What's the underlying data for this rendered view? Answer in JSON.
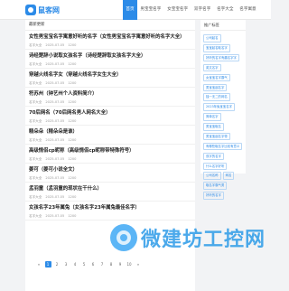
{
  "header": {
    "logo_text": "鼠客网",
    "nav": [
      "首页",
      "男宝宝名字",
      "女宝宝名字",
      "双字名字",
      "名字大全",
      "名字寓意"
    ]
  },
  "main": {
    "title": "最新更新",
    "articles": [
      {
        "title": "女性男宝宝名字寓意好听的名字（女性男宝宝名字寓意好听的名字大全）",
        "author": "名字大全",
        "date": "2025-07-05",
        "views": "1200"
      },
      {
        "title": "诗经楚辞小说取女孩名字（诗经楚辞取女孩名字大全）",
        "author": "名字大全",
        "date": "2025-07-05",
        "views": "1200"
      },
      {
        "title": "穿越火线名字女（穿越火线名字女生大全）",
        "author": "名字大全",
        "date": "2025-07-05",
        "views": "1200"
      },
      {
        "title": "符苏州（钟艺州个人资料简介）",
        "author": "名字大全",
        "date": "2025-07-05",
        "views": "1200"
      },
      {
        "title": "70后网名（70后网名男人网名大全）",
        "author": "名字大全",
        "date": "2025-07-05",
        "views": "1200"
      },
      {
        "title": "精朵朵（精朵朵是谁）",
        "author": "名字大全",
        "date": "2025-07-05",
        "views": "1200"
      },
      {
        "title": "高级情侣cp昵称（高级情侣cp昵称带特殊符号）",
        "author": "名字大全",
        "date": "2025-07-05",
        "views": "1200"
      },
      {
        "title": "姜可（姜可小说全文）",
        "author": "名字大全",
        "date": "2025-07-05",
        "views": "1200"
      },
      {
        "title": "孟羽童（孟羽童的现状在干什么）",
        "author": "名字大全",
        "date": "2025-07-05",
        "views": "1200"
      },
      {
        "title": "女孩名字23年属兔（女孩名字23年属兔最佳名字）",
        "author": "名字大全",
        "date": "2025-07-05",
        "views": "1200"
      }
    ],
    "pagination": [
      "«",
      "1",
      "2",
      "3",
      "4",
      "5",
      "6",
      "7",
      "8",
      "9",
      "10",
      "»"
    ]
  },
  "side": {
    "title": "推广标签",
    "tags": [
      "公司起名",
      "宝宝起名取名字",
      "好听的名字有趣名字字",
      "英文名字",
      "女宝宝名字霸气",
      "男宝宝起名字",
      "独一无二的网名",
      "2023年兔宝宝名字",
      "简单名字",
      "男宝宝取名",
      "男宝宝起名字带",
      "有哪些取名字比较有意义",
      "双字的名字",
      "什么名字好听",
      "公司名称",
      "网名",
      "取名字霸气男",
      "好听的名字"
    ]
  },
  "watermark": {
    "text": "微建坊工控网"
  }
}
